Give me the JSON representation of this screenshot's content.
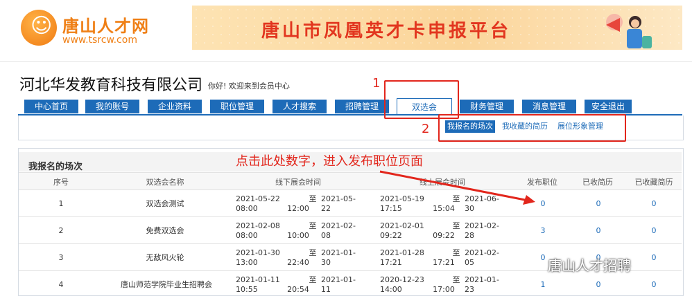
{
  "header": {
    "logo_title": "唐山人才网",
    "logo_url": "www.tsrcw.com",
    "banner_text": "唐山市凤凰英才卡申报平台"
  },
  "company": {
    "name": "河北华发教育科技有限公司",
    "greeting": "你好! 欢迎来到会员中心"
  },
  "nav": {
    "items": [
      {
        "label": "中心首页"
      },
      {
        "label": "我的账号"
      },
      {
        "label": "企业资料"
      },
      {
        "label": "职位管理"
      },
      {
        "label": "人才搜索"
      },
      {
        "label": "招聘管理"
      },
      {
        "label": "双选会"
      },
      {
        "label": "财务管理"
      },
      {
        "label": "消息管理"
      },
      {
        "label": "安全退出"
      }
    ],
    "active_index": 6
  },
  "subnav": {
    "items": [
      {
        "label": "我报名的场次"
      },
      {
        "label": "我收藏的简历"
      },
      {
        "label": "展位形象管理"
      }
    ]
  },
  "panel": {
    "title": "我报名的场次",
    "columns": [
      "序号",
      "双选会名称",
      "线下展会时间",
      "线上展会时间",
      "发布职位",
      "已收简历",
      "已收藏简历"
    ],
    "rows": [
      {
        "no": "1",
        "name": "双选会测试",
        "offline_a": "2021-05-22 08:00",
        "offline_b": "2021-05-22",
        "offline_c": "12:00",
        "online_a": "2021-05-19 17:15",
        "online_b": "2021-06-30",
        "online_c": "15:04",
        "jobs": "0",
        "resumes": "0",
        "saved": "0"
      },
      {
        "no": "2",
        "name": "免费双选会",
        "offline_a": "2021-02-08 08:00",
        "offline_b": "2021-02-08",
        "offline_c": "10:00",
        "online_a": "2021-02-01 09:22",
        "online_b": "2021-02-28",
        "online_c": "09:22",
        "jobs": "3",
        "resumes": "0",
        "saved": "0"
      },
      {
        "no": "3",
        "name": "无敌风火轮",
        "offline_a": "2021-01-30 13:00",
        "offline_b": "2021-01-30",
        "offline_c": "22:40",
        "online_a": "2021-01-28 17:21",
        "online_b": "2021-02-05",
        "online_c": "17:21",
        "jobs": "0",
        "resumes": "0",
        "saved": "0"
      },
      {
        "no": "4",
        "name": "唐山师范学院毕业生招聘会",
        "offline_a": "2021-01-11 10:55",
        "offline_b": "2021-01-11",
        "offline_c": "20:54",
        "online_a": "2020-12-23 14:00",
        "online_b": "2021-01-23",
        "online_c": "17:00",
        "jobs": "1",
        "resumes": "0",
        "saved": "0"
      }
    ],
    "to_word": "至"
  },
  "annotations": {
    "num1": "1",
    "num2": "2",
    "hint": "点击此处数字，进入发布职位页面"
  },
  "watermark": "唐山人才招聘",
  "colors": {
    "nav_blue": "#1d6bb8",
    "annotation_red": "#e2261c",
    "brand_orange": "#ef7f15"
  }
}
